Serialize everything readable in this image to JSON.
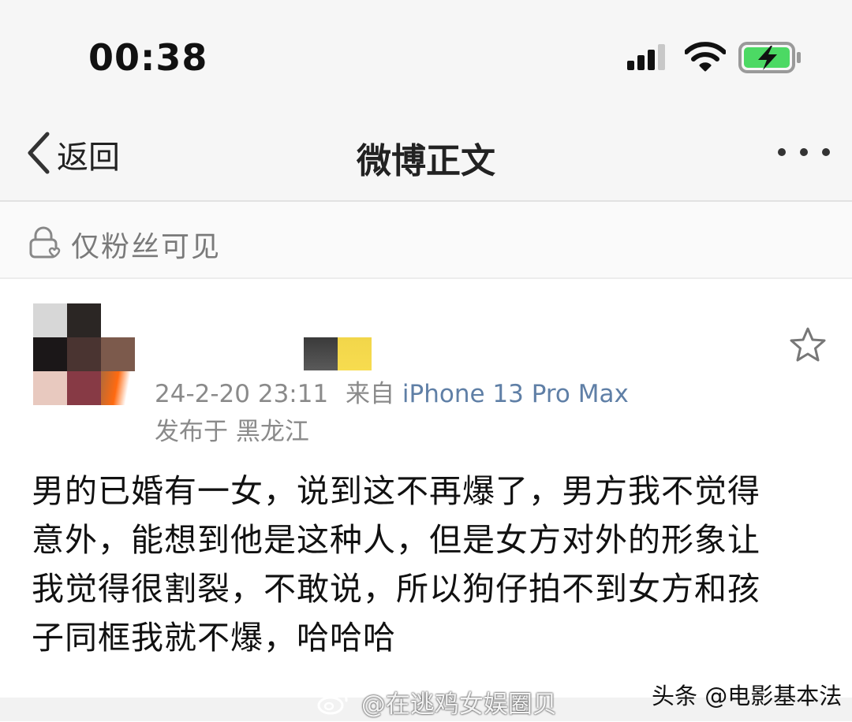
{
  "status_bar": {
    "time": "00:38",
    "icons": [
      "cellular-signal-icon",
      "wifi-icon",
      "battery-charging-icon"
    ],
    "battery_color": "#4cd964"
  },
  "nav": {
    "back_label": "返回",
    "title": "微博正文",
    "more_icon": "more-dots-icon"
  },
  "visibility": {
    "icon": "lock-heart-icon",
    "label": "仅粉丝可见"
  },
  "post": {
    "date_time": "24-2-20 23:11",
    "via_label": "来自",
    "device": "iPhone 13 Pro Max",
    "location": "发布于 黑龙江",
    "favorite_icon": "star-outline-icon",
    "body_lines": [
      "男的已婚有一女，说到这不再爆了，男方我不觉得",
      "意外，能想到他是这种人，但是女方对外的形象让",
      "我觉得很割裂，不敢说，所以狗仔拍不到女方和孩",
      "子同框我就不爆，哈哈哈"
    ]
  },
  "watermarks": {
    "weibo": "@在逃鸡女娱圈贝",
    "toutiao": "头条 @电影基本法"
  }
}
